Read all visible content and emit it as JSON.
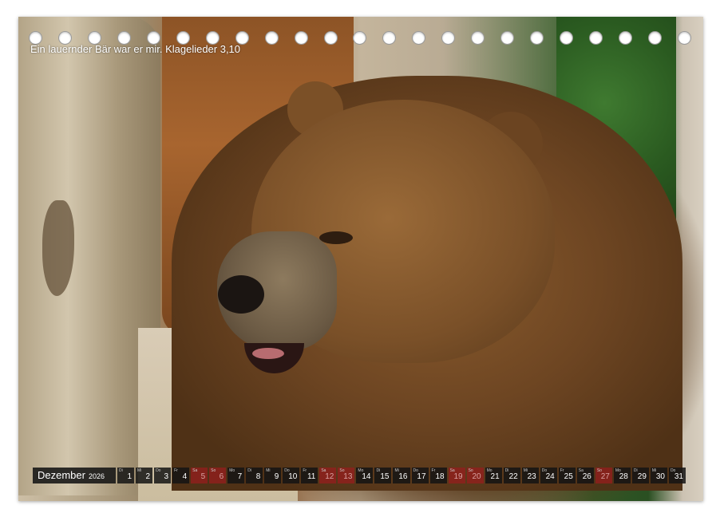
{
  "caption": "Ein lauernder Bär war er mir. Klagelieder 3,10",
  "ring_holes_count": 23,
  "calendar": {
    "month": "Dezember",
    "year": "2026",
    "days": [
      {
        "dow": "Di",
        "num": "1",
        "weekend": false
      },
      {
        "dow": "Mi",
        "num": "2",
        "weekend": false
      },
      {
        "dow": "Do",
        "num": "3",
        "weekend": false
      },
      {
        "dow": "Fr",
        "num": "4",
        "weekend": false
      },
      {
        "dow": "Sa",
        "num": "5",
        "weekend": true
      },
      {
        "dow": "So",
        "num": "6",
        "weekend": true
      },
      {
        "dow": "Mo",
        "num": "7",
        "weekend": false
      },
      {
        "dow": "Di",
        "num": "8",
        "weekend": false
      },
      {
        "dow": "Mi",
        "num": "9",
        "weekend": false
      },
      {
        "dow": "Do",
        "num": "10",
        "weekend": false
      },
      {
        "dow": "Fr",
        "num": "11",
        "weekend": false
      },
      {
        "dow": "Sa",
        "num": "12",
        "weekend": true
      },
      {
        "dow": "So",
        "num": "13",
        "weekend": true
      },
      {
        "dow": "Mo",
        "num": "14",
        "weekend": false
      },
      {
        "dow": "Di",
        "num": "15",
        "weekend": false
      },
      {
        "dow": "Mi",
        "num": "16",
        "weekend": false
      },
      {
        "dow": "Do",
        "num": "17",
        "weekend": false
      },
      {
        "dow": "Fr",
        "num": "18",
        "weekend": false
      },
      {
        "dow": "Sa",
        "num": "19",
        "weekend": true
      },
      {
        "dow": "So",
        "num": "20",
        "weekend": true
      },
      {
        "dow": "Mo",
        "num": "21",
        "weekend": false
      },
      {
        "dow": "Di",
        "num": "22",
        "weekend": false
      },
      {
        "dow": "Mi",
        "num": "23",
        "weekend": false
      },
      {
        "dow": "Do",
        "num": "24",
        "weekend": false
      },
      {
        "dow": "Fr",
        "num": "25",
        "weekend": false
      },
      {
        "dow": "Sa",
        "num": "26",
        "weekend": false
      },
      {
        "dow": "So",
        "num": "27",
        "weekend": true
      },
      {
        "dow": "Mo",
        "num": "28",
        "weekend": false
      },
      {
        "dow": "Di",
        "num": "29",
        "weekend": false
      },
      {
        "dow": "Mi",
        "num": "30",
        "weekend": false
      },
      {
        "dow": "Do",
        "num": "31",
        "weekend": false
      }
    ]
  },
  "colors": {
    "calendar_bar": "#141414",
    "weekend_accent": "#961e1e",
    "caption_text": "#ffffff"
  }
}
